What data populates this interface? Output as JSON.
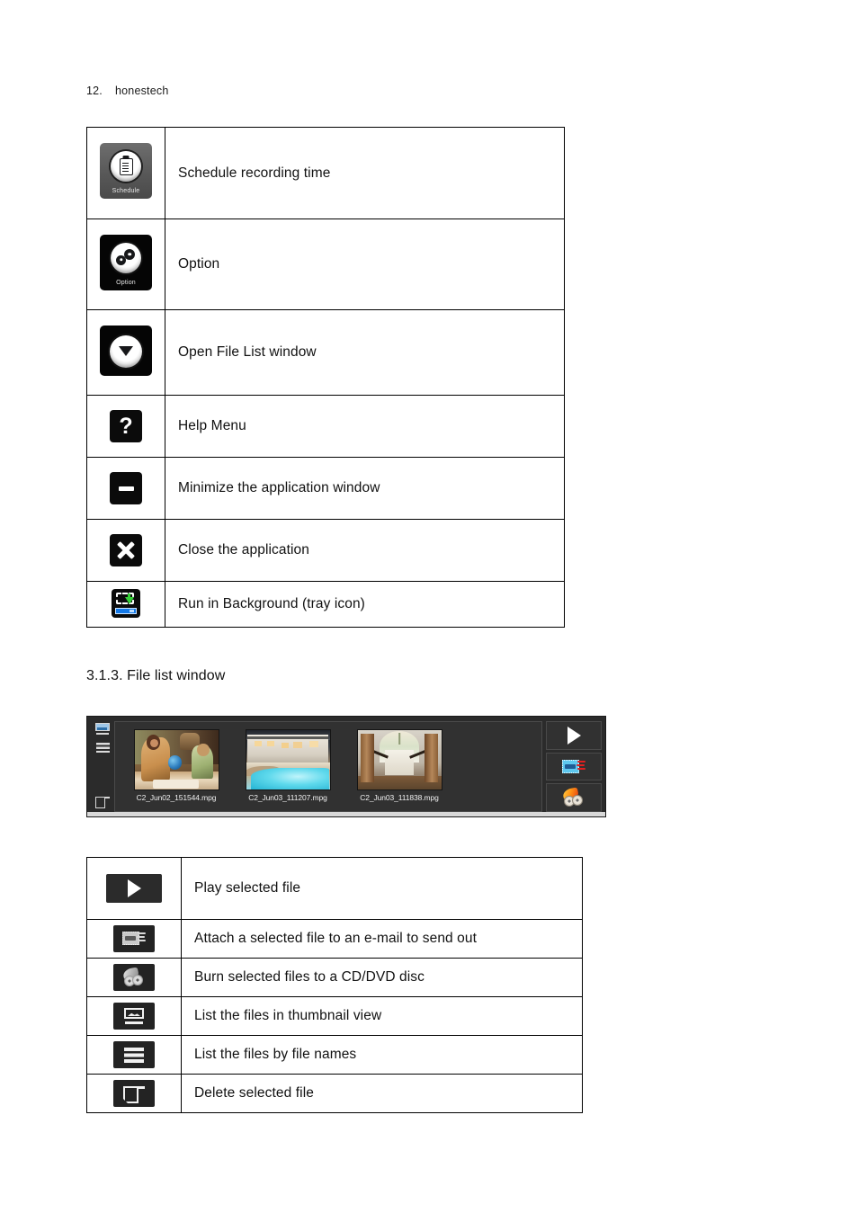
{
  "header": {
    "number": "12.",
    "brand": "honestech"
  },
  "toolbar_table": {
    "rows": [
      {
        "icon": "schedule-icon",
        "icon_label": "Schedule",
        "description": "Schedule recording time"
      },
      {
        "icon": "option-icon",
        "icon_label": "Option",
        "description": "Option"
      },
      {
        "icon": "open-file-list-icon",
        "icon_label": "",
        "description": "Open File List window"
      },
      {
        "icon": "help-icon",
        "icon_label": "?",
        "description": "Help Menu"
      },
      {
        "icon": "minimize-icon",
        "icon_label": "",
        "description": "Minimize the application window"
      },
      {
        "icon": "close-icon",
        "icon_label": "",
        "description": "Close the application"
      },
      {
        "icon": "tray-icon",
        "icon_label": "",
        "description": "Run in Background (tray icon)"
      }
    ]
  },
  "section": {
    "heading": "3.1.3. File list window"
  },
  "file_list_window": {
    "sidebar": [
      {
        "icon": "thumbnail-view-icon",
        "name": "List the files in thumbnail view"
      },
      {
        "icon": "list-view-icon",
        "name": "List the files by file names"
      },
      {
        "icon": "delete-file-icon",
        "name": "Delete selected file"
      }
    ],
    "files": [
      {
        "name": "C2_Jun02_151544.mpg",
        "thumbnail": "family-with-globe"
      },
      {
        "name": "C2_Jun03_111207.mpg",
        "thumbnail": "house-with-pool"
      },
      {
        "name": "C2_Jun03_111838.mpg",
        "thumbnail": "staircase-entry"
      }
    ],
    "actions": [
      {
        "icon": "play-icon",
        "name": "Play selected file"
      },
      {
        "icon": "email-icon",
        "name": "Attach a selected file to an e-mail to send out"
      },
      {
        "icon": "burn-disc-icon",
        "name": "Burn selected files to a CD/DVD disc"
      }
    ]
  },
  "filelist_table": {
    "rows": [
      {
        "icon": "play-icon",
        "description": "Play selected file"
      },
      {
        "icon": "email-icon",
        "description": "Attach a selected file to an e-mail to send out"
      },
      {
        "icon": "burn-disc-icon",
        "description": "Burn selected files to a CD/DVD disc"
      },
      {
        "icon": "thumbnail-view-icon",
        "description": "List the files in thumbnail view"
      },
      {
        "icon": "list-view-icon",
        "description": "List the files by file names"
      },
      {
        "icon": "delete-file-icon",
        "description": "Delete selected file"
      }
    ]
  },
  "colors": {
    "accent_blue": "#1479e8",
    "accent_green": "#35d037",
    "accent_red": "#e02020",
    "window_bg": "#2b2b2b",
    "panel_bg": "#313131"
  }
}
